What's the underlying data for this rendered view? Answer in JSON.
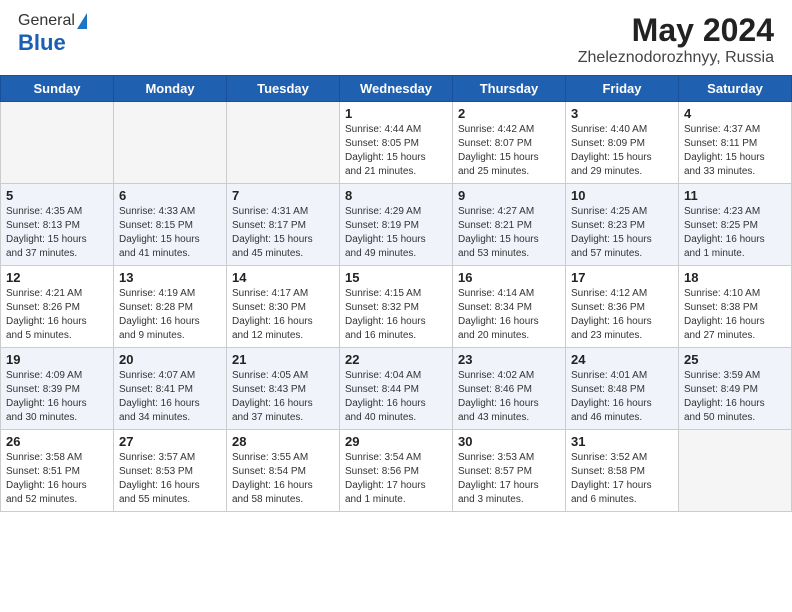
{
  "header": {
    "logo_general": "General",
    "logo_blue": "Blue",
    "title_month": "May 2024",
    "title_location": "Zheleznodorozhnyy, Russia"
  },
  "days_of_week": [
    "Sunday",
    "Monday",
    "Tuesday",
    "Wednesday",
    "Thursday",
    "Friday",
    "Saturday"
  ],
  "weeks": [
    [
      {
        "day": "",
        "detail": ""
      },
      {
        "day": "",
        "detail": ""
      },
      {
        "day": "",
        "detail": ""
      },
      {
        "day": "1",
        "detail": "Sunrise: 4:44 AM\nSunset: 8:05 PM\nDaylight: 15 hours\nand 21 minutes."
      },
      {
        "day": "2",
        "detail": "Sunrise: 4:42 AM\nSunset: 8:07 PM\nDaylight: 15 hours\nand 25 minutes."
      },
      {
        "day": "3",
        "detail": "Sunrise: 4:40 AM\nSunset: 8:09 PM\nDaylight: 15 hours\nand 29 minutes."
      },
      {
        "day": "4",
        "detail": "Sunrise: 4:37 AM\nSunset: 8:11 PM\nDaylight: 15 hours\nand 33 minutes."
      }
    ],
    [
      {
        "day": "5",
        "detail": "Sunrise: 4:35 AM\nSunset: 8:13 PM\nDaylight: 15 hours\nand 37 minutes."
      },
      {
        "day": "6",
        "detail": "Sunrise: 4:33 AM\nSunset: 8:15 PM\nDaylight: 15 hours\nand 41 minutes."
      },
      {
        "day": "7",
        "detail": "Sunrise: 4:31 AM\nSunset: 8:17 PM\nDaylight: 15 hours\nand 45 minutes."
      },
      {
        "day": "8",
        "detail": "Sunrise: 4:29 AM\nSunset: 8:19 PM\nDaylight: 15 hours\nand 49 minutes."
      },
      {
        "day": "9",
        "detail": "Sunrise: 4:27 AM\nSunset: 8:21 PM\nDaylight: 15 hours\nand 53 minutes."
      },
      {
        "day": "10",
        "detail": "Sunrise: 4:25 AM\nSunset: 8:23 PM\nDaylight: 15 hours\nand 57 minutes."
      },
      {
        "day": "11",
        "detail": "Sunrise: 4:23 AM\nSunset: 8:25 PM\nDaylight: 16 hours\nand 1 minute."
      }
    ],
    [
      {
        "day": "12",
        "detail": "Sunrise: 4:21 AM\nSunset: 8:26 PM\nDaylight: 16 hours\nand 5 minutes."
      },
      {
        "day": "13",
        "detail": "Sunrise: 4:19 AM\nSunset: 8:28 PM\nDaylight: 16 hours\nand 9 minutes."
      },
      {
        "day": "14",
        "detail": "Sunrise: 4:17 AM\nSunset: 8:30 PM\nDaylight: 16 hours\nand 12 minutes."
      },
      {
        "day": "15",
        "detail": "Sunrise: 4:15 AM\nSunset: 8:32 PM\nDaylight: 16 hours\nand 16 minutes."
      },
      {
        "day": "16",
        "detail": "Sunrise: 4:14 AM\nSunset: 8:34 PM\nDaylight: 16 hours\nand 20 minutes."
      },
      {
        "day": "17",
        "detail": "Sunrise: 4:12 AM\nSunset: 8:36 PM\nDaylight: 16 hours\nand 23 minutes."
      },
      {
        "day": "18",
        "detail": "Sunrise: 4:10 AM\nSunset: 8:38 PM\nDaylight: 16 hours\nand 27 minutes."
      }
    ],
    [
      {
        "day": "19",
        "detail": "Sunrise: 4:09 AM\nSunset: 8:39 PM\nDaylight: 16 hours\nand 30 minutes."
      },
      {
        "day": "20",
        "detail": "Sunrise: 4:07 AM\nSunset: 8:41 PM\nDaylight: 16 hours\nand 34 minutes."
      },
      {
        "day": "21",
        "detail": "Sunrise: 4:05 AM\nSunset: 8:43 PM\nDaylight: 16 hours\nand 37 minutes."
      },
      {
        "day": "22",
        "detail": "Sunrise: 4:04 AM\nSunset: 8:44 PM\nDaylight: 16 hours\nand 40 minutes."
      },
      {
        "day": "23",
        "detail": "Sunrise: 4:02 AM\nSunset: 8:46 PM\nDaylight: 16 hours\nand 43 minutes."
      },
      {
        "day": "24",
        "detail": "Sunrise: 4:01 AM\nSunset: 8:48 PM\nDaylight: 16 hours\nand 46 minutes."
      },
      {
        "day": "25",
        "detail": "Sunrise: 3:59 AM\nSunset: 8:49 PM\nDaylight: 16 hours\nand 50 minutes."
      }
    ],
    [
      {
        "day": "26",
        "detail": "Sunrise: 3:58 AM\nSunset: 8:51 PM\nDaylight: 16 hours\nand 52 minutes."
      },
      {
        "day": "27",
        "detail": "Sunrise: 3:57 AM\nSunset: 8:53 PM\nDaylight: 16 hours\nand 55 minutes."
      },
      {
        "day": "28",
        "detail": "Sunrise: 3:55 AM\nSunset: 8:54 PM\nDaylight: 16 hours\nand 58 minutes."
      },
      {
        "day": "29",
        "detail": "Sunrise: 3:54 AM\nSunset: 8:56 PM\nDaylight: 17 hours\nand 1 minute."
      },
      {
        "day": "30",
        "detail": "Sunrise: 3:53 AM\nSunset: 8:57 PM\nDaylight: 17 hours\nand 3 minutes."
      },
      {
        "day": "31",
        "detail": "Sunrise: 3:52 AM\nSunset: 8:58 PM\nDaylight: 17 hours\nand 6 minutes."
      },
      {
        "day": "",
        "detail": ""
      }
    ]
  ]
}
